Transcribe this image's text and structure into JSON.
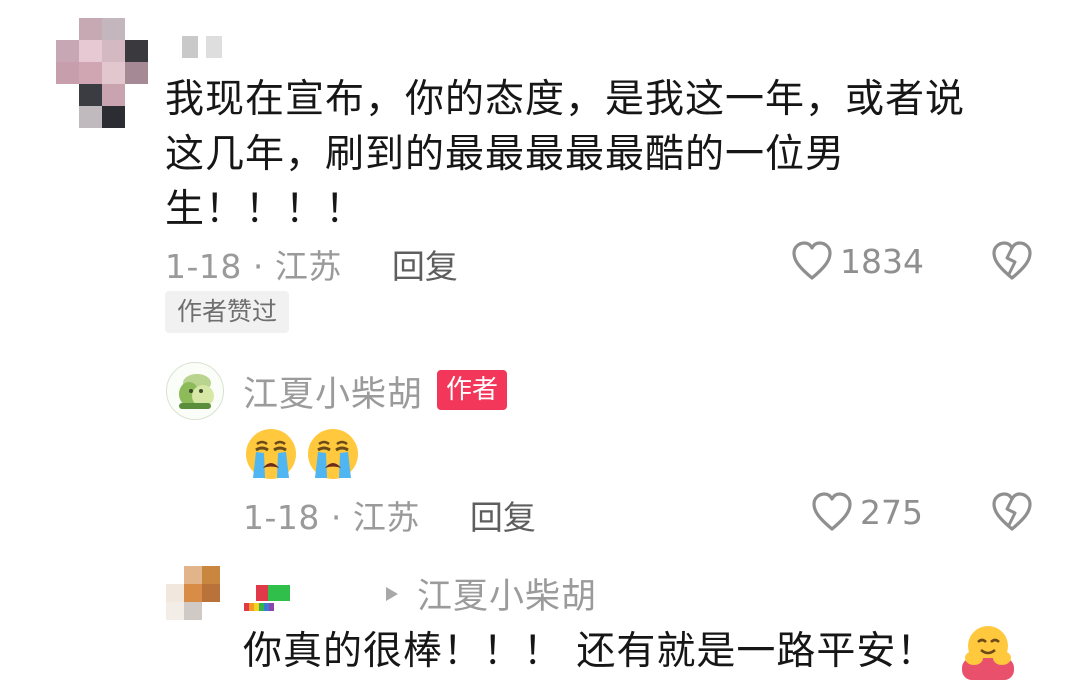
{
  "colors": {
    "text_primary": "#161616",
    "text_secondary": "#9a9a9a",
    "author_tag_bg": "#f2375a",
    "badge_bg": "#f1f1f1"
  },
  "comment": {
    "lines": [
      "我现在宣布，你的态度，是我这一年，或者说",
      "这几年，刷到的最最最最最酷的一位男",
      "生！！！！"
    ],
    "date_location": "1-18 · 江苏",
    "reply_label": "回复",
    "likes": "1834",
    "author_liked_badge": "作者赞过",
    "icons": [
      "heart-outline-icon",
      "broken-heart-icon"
    ]
  },
  "author_reply": {
    "name": "江夏小柴胡",
    "tag": "作者",
    "emojis": [
      "loudly-crying-face-emoji",
      "loudly-crying-face-emoji"
    ],
    "date_location": "1-18 · 江苏",
    "reply_label": "回复",
    "likes": "275",
    "icons": [
      "heart-outline-icon",
      "broken-heart-icon"
    ]
  },
  "third_reply": {
    "reply_to_name": "江夏小柴胡",
    "text": "你真的很棒！！！ 还有就是一路平安！",
    "emoji": "hugging-face-emoji"
  }
}
